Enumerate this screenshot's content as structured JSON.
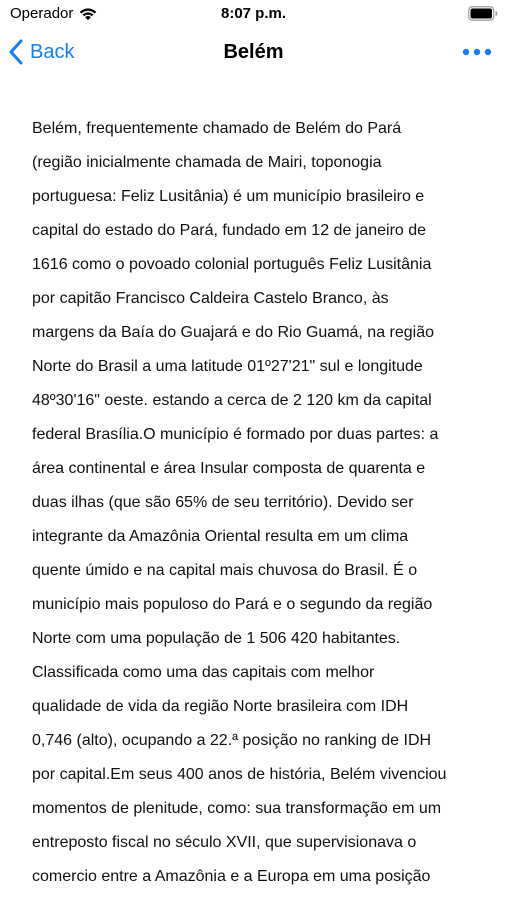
{
  "status_bar": {
    "carrier": "Operador",
    "time": "8:07 p.m.",
    "wifi_icon": "wifi-icon",
    "battery_icon": "battery-icon"
  },
  "nav": {
    "back_label": "Back",
    "title": "Belém",
    "back_icon": "chevron-left-icon",
    "more_icon": "ellipsis-icon",
    "accent_color": "#1a7cf3"
  },
  "article": {
    "lines": [
      "Belém, frequentemente chamado de Belém do Pará",
      "(região inicialmente chamada de Mairi, toponogia",
      "portuguesa: Feliz Lusitânia) é um município brasileiro e",
      "capital do estado do Pará, fundado em 12 de janeiro de",
      "1616 como o povoado colonial português Feliz Lusitânia",
      "por capitão Francisco Caldeira Castelo Branco, às",
      "margens da Baía do Guajará e do Rio Guamá, na região",
      "Norte do Brasil a uma latitude 01º27'21\" sul e longitude",
      "48º30'16\" oeste. estando a cerca de 2 120 km da capital",
      "federal Brasília.O município é formado por duas partes: a",
      "área continental e área Insular composta de quarenta e",
      "duas ilhas (que são 65% de seu território). Devido ser",
      "integrante da Amazônia Oriental resulta em um clima",
      "quente úmido e na capital mais chuvosa do Brasil. É o",
      "município mais populoso do Pará e o segundo da região",
      "Norte com uma população de 1 506 420 habitantes.",
      "Classificada como uma das capitais com melhor",
      "qualidade de vida da região Norte brasileira com IDH",
      "0,746 (alto), ocupando a 22.ª posição no ranking de IDH",
      "por capital.Em seus 400 anos de história, Belém vivenciou",
      "momentos de plenitude, como: sua transformação em um",
      "entreposto fiscal no século XVII, que supervisionava o",
      "comercio entre a Amazônia e a Europa em uma posição"
    ]
  }
}
